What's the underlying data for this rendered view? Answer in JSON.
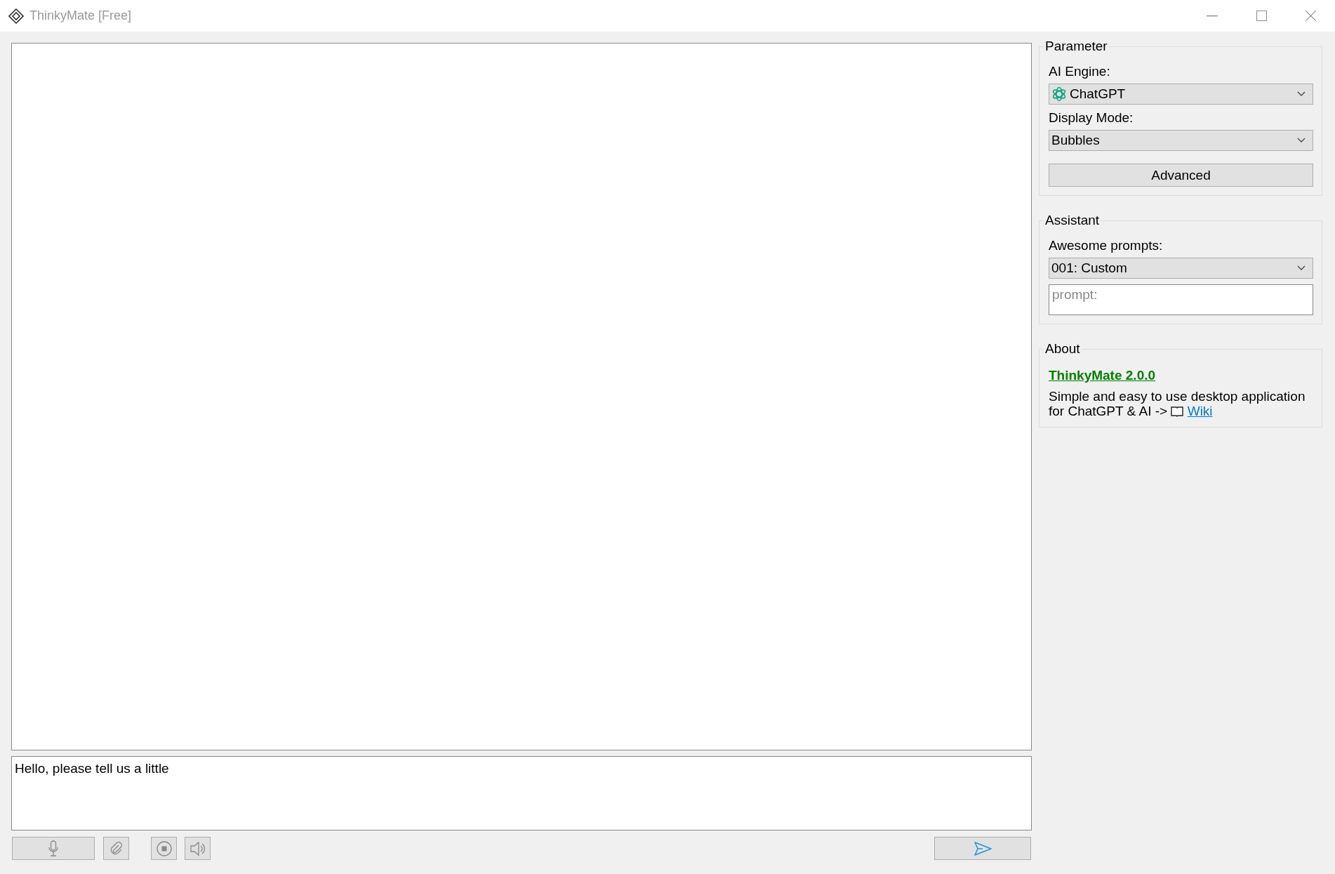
{
  "window": {
    "title": "ThinkyMate [Free]"
  },
  "chat": {
    "input_value": "Hello, please tell us a little"
  },
  "parameter": {
    "title": "Parameter",
    "engine_label": "AI Engine:",
    "engine_value": "ChatGPT",
    "display_label": "Display Mode:",
    "display_value": "Bubbles",
    "advanced_button": "Advanced"
  },
  "assistant": {
    "title": "Assistant",
    "prompts_label": "Awesome prompts:",
    "prompts_value": "001: Custom",
    "prompt": {
      "placeholder": "prompt:"
    }
  },
  "about": {
    "title": "About",
    "app_link": "ThinkyMate 2.0.0",
    "description": "Simple and easy to use desktop application for ChatGPT & AI ->",
    "wiki_link": "Wiki"
  }
}
